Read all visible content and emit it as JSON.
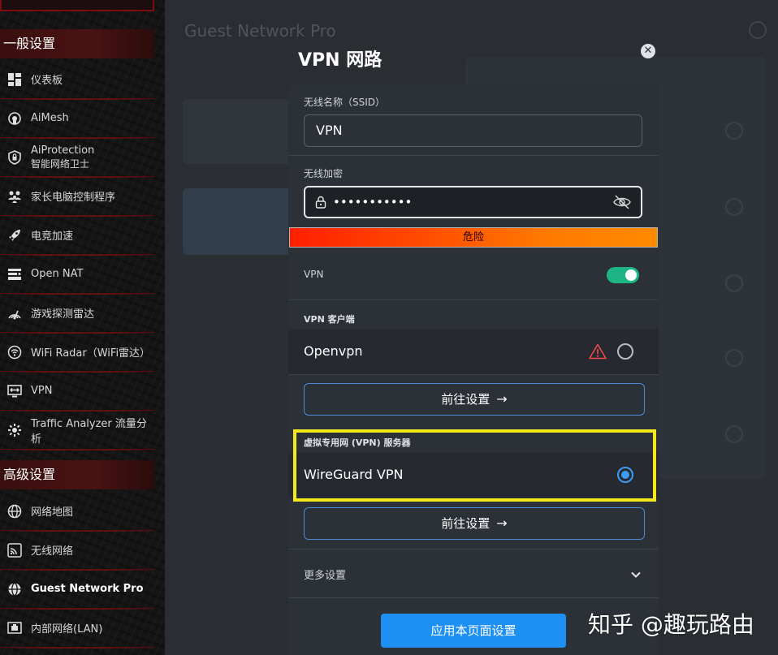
{
  "sidebar": {
    "section_general": "一般设置",
    "section_advanced": "高级设置",
    "items": [
      {
        "label": "仪表板",
        "icon": "dashboard-icon"
      },
      {
        "label": "AiMesh",
        "icon": "aimesh-icon"
      },
      {
        "label": "AiProtection",
        "label2": "智能网络卫士",
        "icon": "shield-lock-icon"
      },
      {
        "label": "家长电脑控制程序",
        "icon": "family-icon"
      },
      {
        "label": "电竞加速",
        "icon": "rocket-icon"
      },
      {
        "label": "Open NAT",
        "icon": "open-nat-icon"
      },
      {
        "label": "游戏探测雷达",
        "icon": "game-radar-icon"
      },
      {
        "label": "WiFi Radar（WiFi雷达）",
        "icon": "wifi-radar-icon"
      },
      {
        "label": "VPN",
        "icon": "vpn-icon"
      },
      {
        "label": "Traffic Analyzer 流量分析",
        "icon": "traffic-analyzer-icon"
      },
      {
        "label": "网络地图",
        "icon": "globe-icon"
      },
      {
        "label": "无线网络",
        "icon": "wireless-icon"
      },
      {
        "label": "Guest Network Pro",
        "icon": "guest-globe-icon"
      },
      {
        "label": "内部网络(LAN)",
        "icon": "lan-icon"
      }
    ]
  },
  "background": {
    "header": "Guest Network Pro"
  },
  "modal": {
    "title": "VPN 网路",
    "close_symbol": "✕",
    "ssid_label": "无线名称（SSID）",
    "ssid_value": "VPN",
    "encryption_label": "无线加密",
    "password_mask": "•••••••••••",
    "strength_text": "危险",
    "vpn_label": "VPN",
    "vpn_enabled": true,
    "vpn_client_heading": "VPN 客户端",
    "client_option": "Openvpn",
    "goto_label": "前往设置",
    "arrow": "→",
    "vpn_server_heading": "虚拟专用网 (VPN) 服务器",
    "server_option": "WireGuard VPN",
    "more_settings": "更多设置",
    "apply_label": "应用本页面设置"
  },
  "watermark": "知乎 @趣玩路由",
  "colors": {
    "accent_blue": "#1e90f3",
    "toggle_green": "#1db584",
    "highlight_yellow": "#f4ea1b",
    "danger_red": "#ff1f00",
    "sidebar_red": "#b01515"
  }
}
